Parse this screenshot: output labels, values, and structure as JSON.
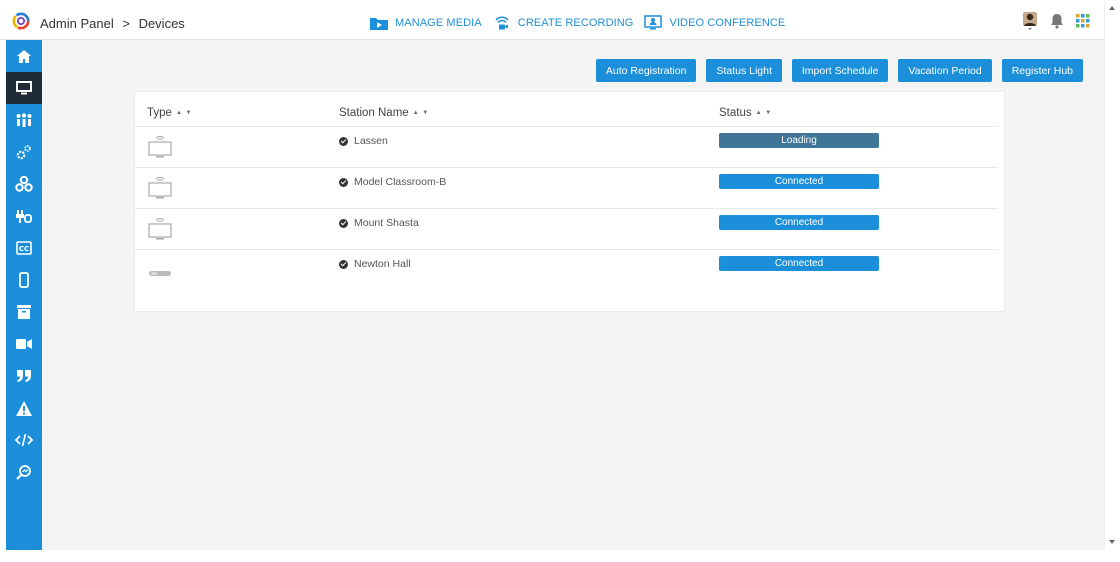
{
  "header": {
    "breadcrumb": {
      "root": "Admin Panel",
      "separator": ">",
      "current": "Devices"
    },
    "nav": [
      {
        "icon": "folder-media-icon",
        "label": "MANAGE MEDIA"
      },
      {
        "icon": "recording-icon",
        "label": "CREATE RECORDING"
      },
      {
        "icon": "video-conference-icon",
        "label": "VIDEO CONFERENCE"
      }
    ],
    "right_icons": [
      "user-avatar-icon",
      "bell-icon",
      "apps-grid-icon"
    ]
  },
  "sidebar": {
    "items": [
      {
        "icon": "home-icon",
        "active": false
      },
      {
        "icon": "monitor-icon",
        "active": true
      },
      {
        "icon": "users-icon",
        "active": false
      },
      {
        "icon": "gears-icon",
        "active": false
      },
      {
        "icon": "network-icon",
        "active": false
      },
      {
        "icon": "plugins-icon",
        "active": false
      },
      {
        "icon": "closed-captions-icon",
        "active": false
      },
      {
        "icon": "mobile-icon",
        "active": false
      },
      {
        "icon": "archive-icon",
        "active": false
      },
      {
        "icon": "video-camera-icon",
        "active": false
      },
      {
        "icon": "quote-icon",
        "active": false
      },
      {
        "icon": "warning-icon",
        "active": false
      },
      {
        "icon": "code-icon",
        "active": false
      },
      {
        "icon": "search-analytics-icon",
        "active": false
      }
    ]
  },
  "actions": {
    "auto_registration": "Auto Registration",
    "status_light": "Status Light",
    "import_schedule": "Import Schedule",
    "vacation_period": "Vacation Period",
    "register_hub": "Register Hub"
  },
  "table": {
    "columns": {
      "type": "Type",
      "station_name": "Station Name",
      "status": "Status"
    },
    "sort_glyph": "▲ ▼",
    "rows": [
      {
        "type_icon": "wifi-monitor-icon",
        "station": "Lassen",
        "status": "Loading"
      },
      {
        "type_icon": "wifi-monitor-icon",
        "station": "Model Classroom-B",
        "status": "Connected"
      },
      {
        "type_icon": "wifi-monitor-icon",
        "station": "Mount Shasta",
        "status": "Connected"
      },
      {
        "type_icon": "hub-device-icon",
        "station": "Newton Hall",
        "status": "Connected"
      }
    ]
  },
  "colors": {
    "accent": "#1c8fdb",
    "sidebar_active": "#1e2a36",
    "status_connected": "#1c8fdb",
    "status_loading": "#3f7596"
  }
}
